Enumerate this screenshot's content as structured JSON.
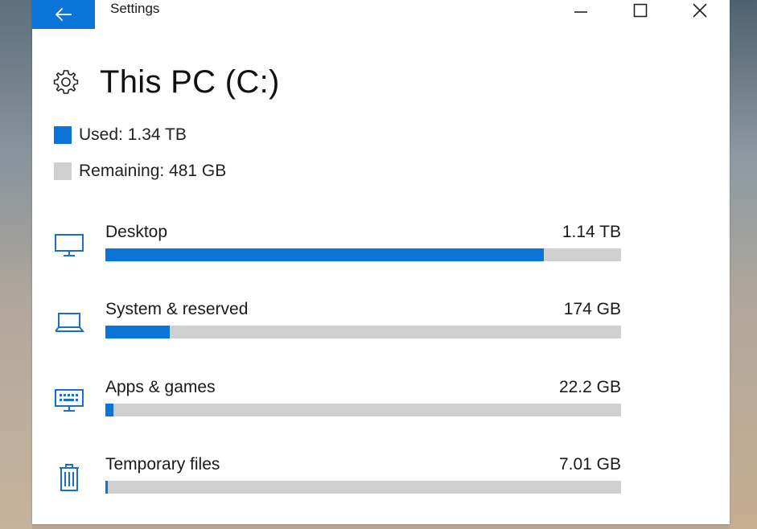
{
  "window": {
    "title": "Settings",
    "back_icon": "arrow-left-icon",
    "controls": [
      "minimize-icon",
      "maximize-icon",
      "close-icon"
    ],
    "accent_color": "#0a74d8"
  },
  "page": {
    "icon": "gear-icon",
    "title": "This PC (C:)"
  },
  "summary": {
    "used_label": "Used: 1.34 TB",
    "used_color": "#0a74d8",
    "remaining_label": "Remaining: 481 GB",
    "remaining_color": "#cfcfcf"
  },
  "categories": [
    {
      "label": "Desktop",
      "size": "1.14 TB",
      "icon": "monitor-icon",
      "fraction": 0.85
    },
    {
      "label": "System & reserved",
      "size": "174 GB",
      "icon": "laptop-icon",
      "fraction": 0.125
    },
    {
      "label": "Apps & games",
      "size": "22.2 GB",
      "icon": "keyboard-monitor-icon",
      "fraction": 0.015
    },
    {
      "label": "Temporary files",
      "size": "7.01 GB",
      "icon": "trash-icon",
      "fraction": 0.005
    }
  ]
}
